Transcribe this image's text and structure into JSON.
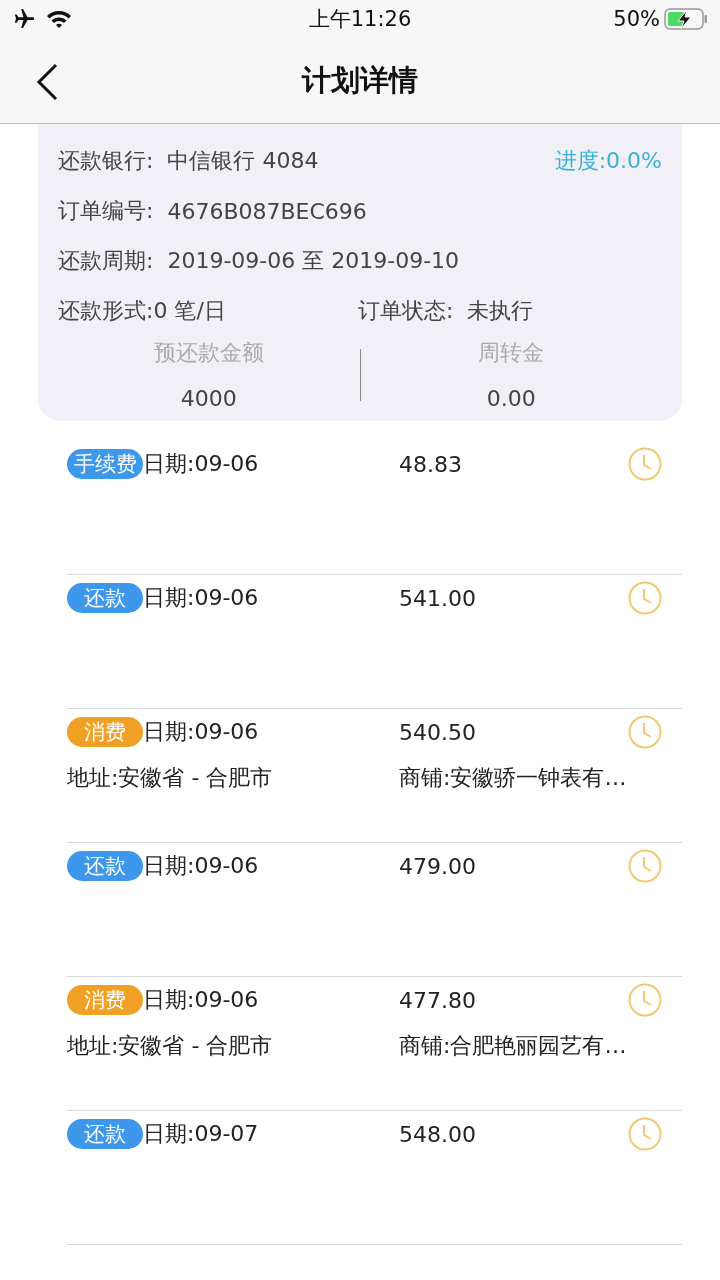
{
  "status_bar": {
    "time": "上午11:26",
    "battery": "50%"
  },
  "nav": {
    "title": "计划详情"
  },
  "summary": {
    "bank_label": "还款银行:",
    "bank": "中信银行 4084",
    "progress": "进度:0.0%",
    "order_label": "订单编号:",
    "order": "4676B087BEC696",
    "period_label": "还款周期:",
    "period": "2019-09-06 至 2019-09-10",
    "form": "还款形式:0 笔/日",
    "status_label": "订单状态:",
    "status": "未执行",
    "amount_label": "预还款金额",
    "amount": "4000",
    "turnover_label": "周转金",
    "turnover": "0.00"
  },
  "entries": [
    {
      "kind": "fee",
      "tag": "手续费",
      "date": "日期:09-06",
      "amount": "48.83"
    },
    {
      "kind": "repay",
      "tag": "还款",
      "date": "日期:09-06",
      "amount": "541.00"
    },
    {
      "kind": "spend",
      "tag": "消费",
      "date": "日期:09-06",
      "amount": "540.50",
      "address": "地址:安徽省 - 合肥市",
      "shop": "商铺:安徽骄一钟表有…"
    },
    {
      "kind": "repay",
      "tag": "还款",
      "date": "日期:09-06",
      "amount": "479.00"
    },
    {
      "kind": "spend",
      "tag": "消费",
      "date": "日期:09-06",
      "amount": "477.80",
      "address": "地址:安徽省 - 合肥市",
      "shop": "商铺:合肥艳丽园艺有…"
    },
    {
      "kind": "repay",
      "tag": "还款",
      "date": "日期:09-07",
      "amount": "548.00"
    }
  ]
}
